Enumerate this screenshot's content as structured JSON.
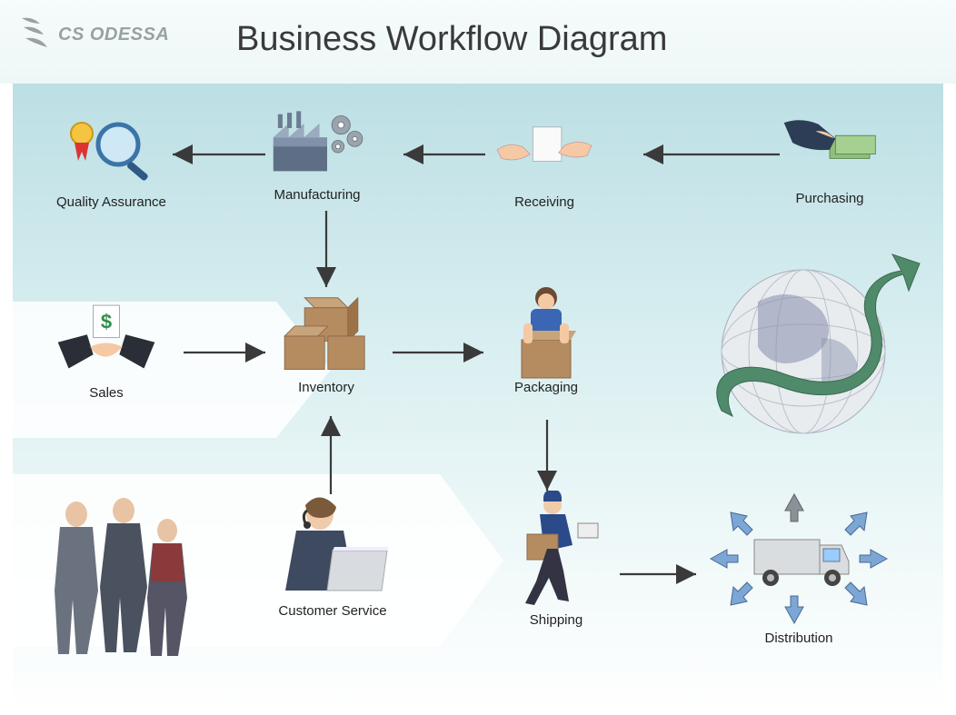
{
  "brand": "CS ODESSA",
  "title": "Business Workflow Diagram",
  "nodes": {
    "qa": "Quality Assurance",
    "manufacturing": "Manufacturing",
    "receiving": "Receiving",
    "purchasing": "Purchasing",
    "sales": "Sales",
    "inventory": "Inventory",
    "packaging": "Packaging",
    "customer_service": "Customer Service",
    "shipping": "Shipping",
    "distribution": "Distribution"
  },
  "flow_edges": [
    [
      "purchasing",
      "receiving"
    ],
    [
      "receiving",
      "manufacturing"
    ],
    [
      "manufacturing",
      "qa"
    ],
    [
      "manufacturing",
      "inventory"
    ],
    [
      "sales",
      "inventory"
    ],
    [
      "inventory",
      "packaging"
    ],
    [
      "customer_service",
      "inventory"
    ],
    [
      "packaging",
      "shipping"
    ],
    [
      "shipping",
      "distribution"
    ]
  ]
}
